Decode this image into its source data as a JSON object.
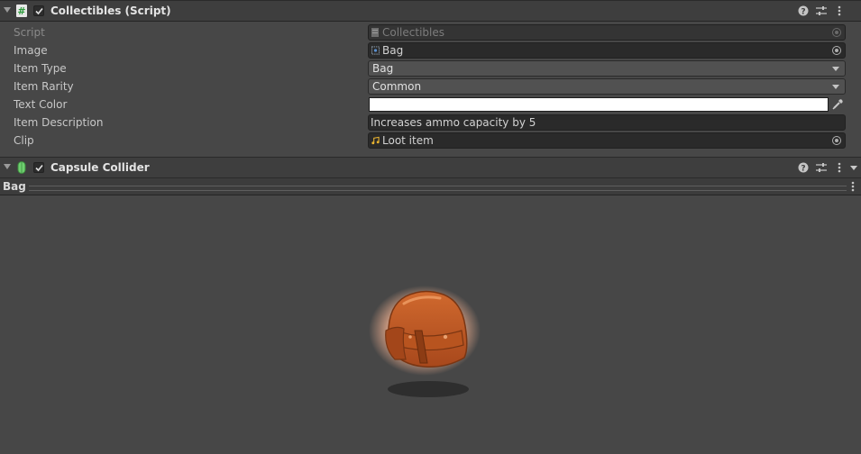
{
  "collectibles": {
    "title": "Collectibles (Script)",
    "icon": "script-hash-icon",
    "fields": {
      "script": {
        "label": "Script",
        "value": "Collectibles"
      },
      "image": {
        "label": "Image",
        "value": "Bag"
      },
      "item_type": {
        "label": "Item Type",
        "value": "Bag"
      },
      "item_rarity": {
        "label": "Item Rarity",
        "value": "Common"
      },
      "text_color": {
        "label": "Text Color",
        "color": "#ffffff"
      },
      "item_description": {
        "label": "Item Description",
        "value": "Increases ammo capacity by 5"
      },
      "clip": {
        "label": "Clip",
        "value": "Loot item"
      }
    }
  },
  "capsule_collider": {
    "title": "Capsule Collider",
    "icon": "capsule-collider-icon"
  },
  "preview": {
    "title": "Bag",
    "image": "bag-sprite"
  },
  "colors": {
    "background": "#474747",
    "header": "#3e3e3e",
    "field": "#2a2a2a",
    "accent_green": "#6fd070",
    "bag_orange": "#c8622a"
  }
}
